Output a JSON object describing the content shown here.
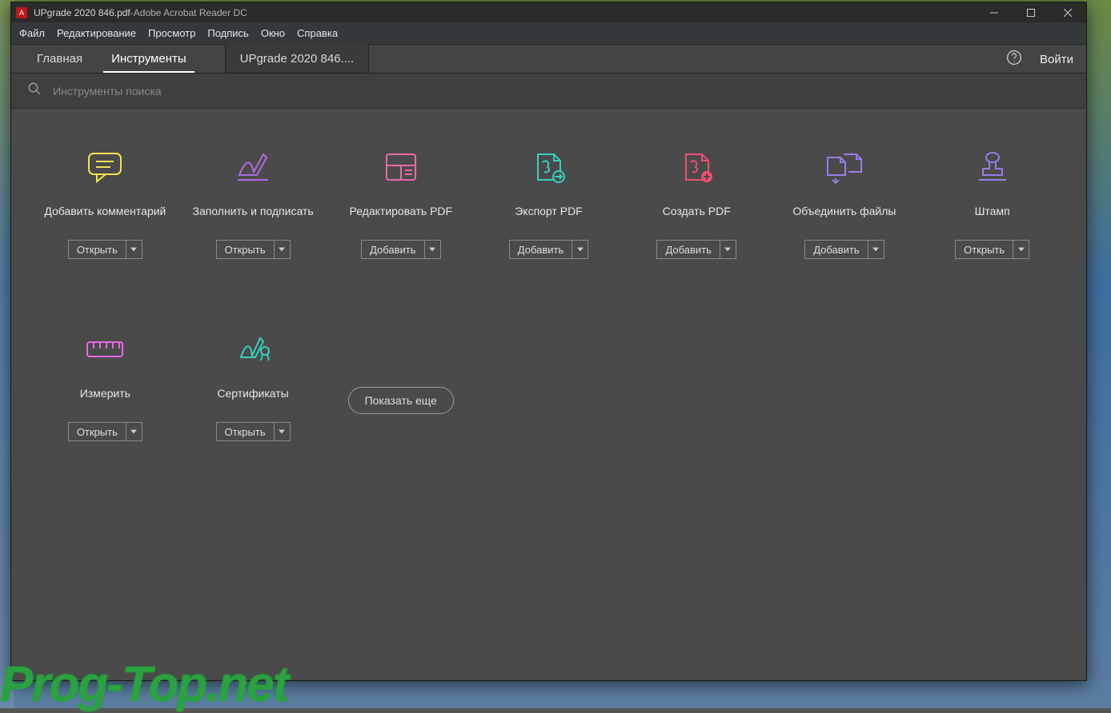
{
  "title": {
    "doc": "UPgrade 2020 846.pdf",
    "sep": " - ",
    "app": "Adobe Acrobat Reader DC"
  },
  "window_controls": {
    "min": "–",
    "max": "☐",
    "close": "✕"
  },
  "menu": {
    "items": [
      "Файл",
      "Редактирование",
      "Просмотр",
      "Подпись",
      "Окно",
      "Справка"
    ]
  },
  "tabs": {
    "home": "Главная",
    "tools": "Инструменты",
    "doc": "UPgrade 2020 846....",
    "login": "Войти"
  },
  "search": {
    "placeholder": "Инструменты поиска"
  },
  "tools": [
    {
      "id": "comment",
      "label": "Добавить комментарий",
      "action": "Открыть",
      "color": "#f2e24a"
    },
    {
      "id": "fillsign",
      "label": "Заполнить и подписать",
      "action": "Открыть",
      "color": "#b26ae0"
    },
    {
      "id": "editpdf",
      "label": "Редактировать PDF",
      "action": "Добавить",
      "color": "#e86aa6"
    },
    {
      "id": "export",
      "label": "Экспорт PDF",
      "action": "Добавить",
      "color": "#36d0bc"
    },
    {
      "id": "create",
      "label": "Создать PDF",
      "action": "Добавить",
      "color": "#ef4d6d"
    },
    {
      "id": "combine",
      "label": "Объединить файлы",
      "action": "Добавить",
      "color": "#9a7de6"
    },
    {
      "id": "stamp",
      "label": "Штамп",
      "action": "Открыть",
      "color": "#9a7de6"
    },
    {
      "id": "measure",
      "label": "Измерить",
      "action": "Открыть",
      "color": "#e86ae0"
    },
    {
      "id": "cert",
      "label": "Сертификаты",
      "action": "Открыть",
      "color": "#36d0bc"
    }
  ],
  "show_more": "Показать еще",
  "watermark": "Prog-Top.net"
}
